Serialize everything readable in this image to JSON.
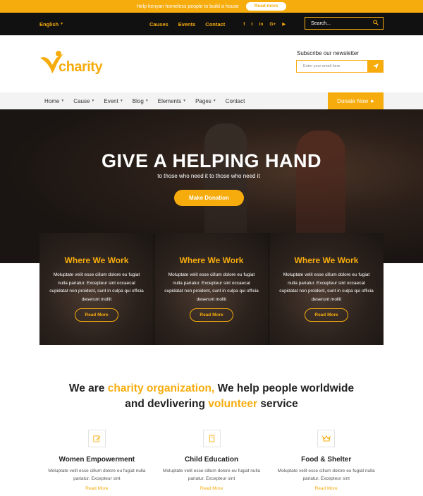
{
  "announcement": {
    "text": "Help kenyan homeless people to build a house",
    "button": "Read more"
  },
  "topbar": {
    "language": "English",
    "nav": [
      "Causes",
      "Events",
      "Contact"
    ],
    "socials": [
      {
        "name": "facebook-icon",
        "glyph": "f"
      },
      {
        "name": "twitter-icon",
        "glyph": "t"
      },
      {
        "name": "linkedin-icon",
        "glyph": "in"
      },
      {
        "name": "google-plus-icon",
        "glyph": "G+"
      },
      {
        "name": "youtube-icon",
        "glyph": "▶"
      }
    ],
    "search_placeholder": "Search..."
  },
  "header": {
    "logo_text": "charity",
    "newsletter_title": "Subscribe our newsletter",
    "newsletter_placeholder": "Enter your email here"
  },
  "mainnav": {
    "items": [
      {
        "label": "Home",
        "dropdown": true
      },
      {
        "label": "Cause",
        "dropdown": true
      },
      {
        "label": "Event",
        "dropdown": true
      },
      {
        "label": "Blog",
        "dropdown": true
      },
      {
        "label": "Elements",
        "dropdown": true
      },
      {
        "label": "Pages",
        "dropdown": true
      },
      {
        "label": "Contact",
        "dropdown": false
      }
    ],
    "donate": "Donate Now"
  },
  "hero": {
    "title": "GIVE A HELPING HAND",
    "subtitle": "to those who need it to those who need it",
    "button": "Make Donation"
  },
  "cards": [
    {
      "title": "Where We Work",
      "text": "Moluptate velit esse cillum dolore eu fugiat nulla pariatur. Excepteur sint occaecat cupidatat non proident, sunt in culpa qui officia deserunt mollit",
      "button": "Read More"
    },
    {
      "title": "Where We Work",
      "text": "Moluptate velit esse cillum dolore eu fugiat nulla pariatur. Excepteur sint occaecat cupidatat non proident, sunt in culpa qui officia deserunt mollit",
      "button": "Read More"
    },
    {
      "title": "Where We Work",
      "text": "Moluptate velit esse cillum dolore eu fugiat nulla pariatur. Excepteur sint occaecat cupidatat non proident, sunt in culpa qui officia deserunt mollit",
      "button": "Read More"
    }
  ],
  "mission": {
    "part1": "We are ",
    "highlight1": "charity organization,",
    "part2": " We help people worldwide",
    "part3": "and devlivering ",
    "highlight2": "volunteer",
    "part4": " service"
  },
  "features": [
    {
      "icon": "edit-icon",
      "title": "Women Empowerment",
      "text": "Moluptate velit esse cillum dolore eu fugiat nulla pariatur. Excepteur sint",
      "link": "Read More"
    },
    {
      "icon": "book-icon",
      "title": "Child Education",
      "text": "Moluptate velit esse cillum dolore eu fugiat nulla pariatur. Excepteur sint",
      "link": "Read More"
    },
    {
      "icon": "crown-icon",
      "title": "Food & Shelter",
      "text": "Moluptate velit esse cillum dolore eu fugiat nulla pariatur. Excepteur sint",
      "link": "Read More"
    }
  ],
  "colors": {
    "accent": "#f7ac0d",
    "dark": "#111111",
    "nav_bg": "#f3f3f3"
  }
}
